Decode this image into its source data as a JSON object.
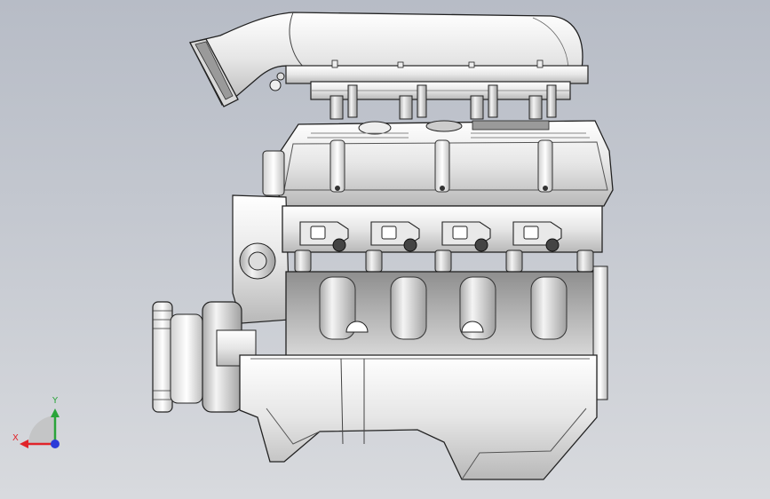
{
  "viewport": {
    "background_top": "#b7bcc6",
    "background_bottom": "#d8dade",
    "model": "engine-assembly"
  },
  "triad": {
    "x_label": "X",
    "y_label": "Y",
    "x_color": "#e0242a",
    "y_color": "#2aa43a",
    "z_color": "#2a3ad8"
  }
}
